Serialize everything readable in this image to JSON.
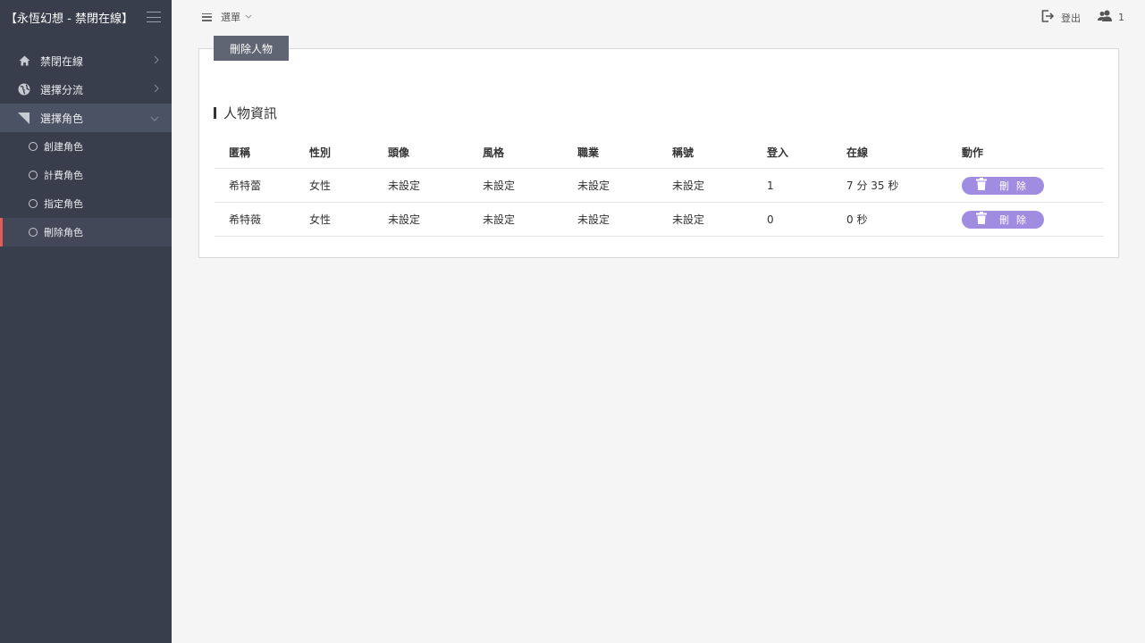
{
  "sidebar": {
    "brand": "【永恆幻想 - 禁閉在線】",
    "items": [
      {
        "label": "禁閉在線",
        "icon": "home-icon"
      },
      {
        "label": "選擇分流",
        "icon": "globe-icon"
      },
      {
        "label": "選擇角色",
        "icon": "corner-arrow-icon"
      }
    ],
    "subitems": [
      {
        "label": "創建角色"
      },
      {
        "label": "計費角色"
      },
      {
        "label": "指定角色"
      },
      {
        "label": "刪除角色"
      }
    ]
  },
  "topbar": {
    "menu_label": "選單",
    "logout_label": "登出",
    "users_count": "1"
  },
  "card": {
    "tab_label": "刪除人物",
    "section_title": "人物資訊"
  },
  "table": {
    "headers": [
      "匿稱",
      "性別",
      "頭像",
      "風格",
      "職業",
      "稱號",
      "登入",
      "在線",
      "動作"
    ],
    "rows": [
      [
        "希特蕾",
        "女性",
        "未設定",
        "未設定",
        "未設定",
        "未設定",
        "1",
        "7 分 35 秒"
      ],
      [
        "希特薇",
        "女性",
        "未設定",
        "未設定",
        "未設定",
        "未設定",
        "0",
        "0 秒"
      ]
    ],
    "delete_label": "刪除"
  },
  "colors": {
    "sidebar_bg": "#383e4b",
    "active_accent": "#e35b5b",
    "delete_button": "#a08ce0"
  }
}
